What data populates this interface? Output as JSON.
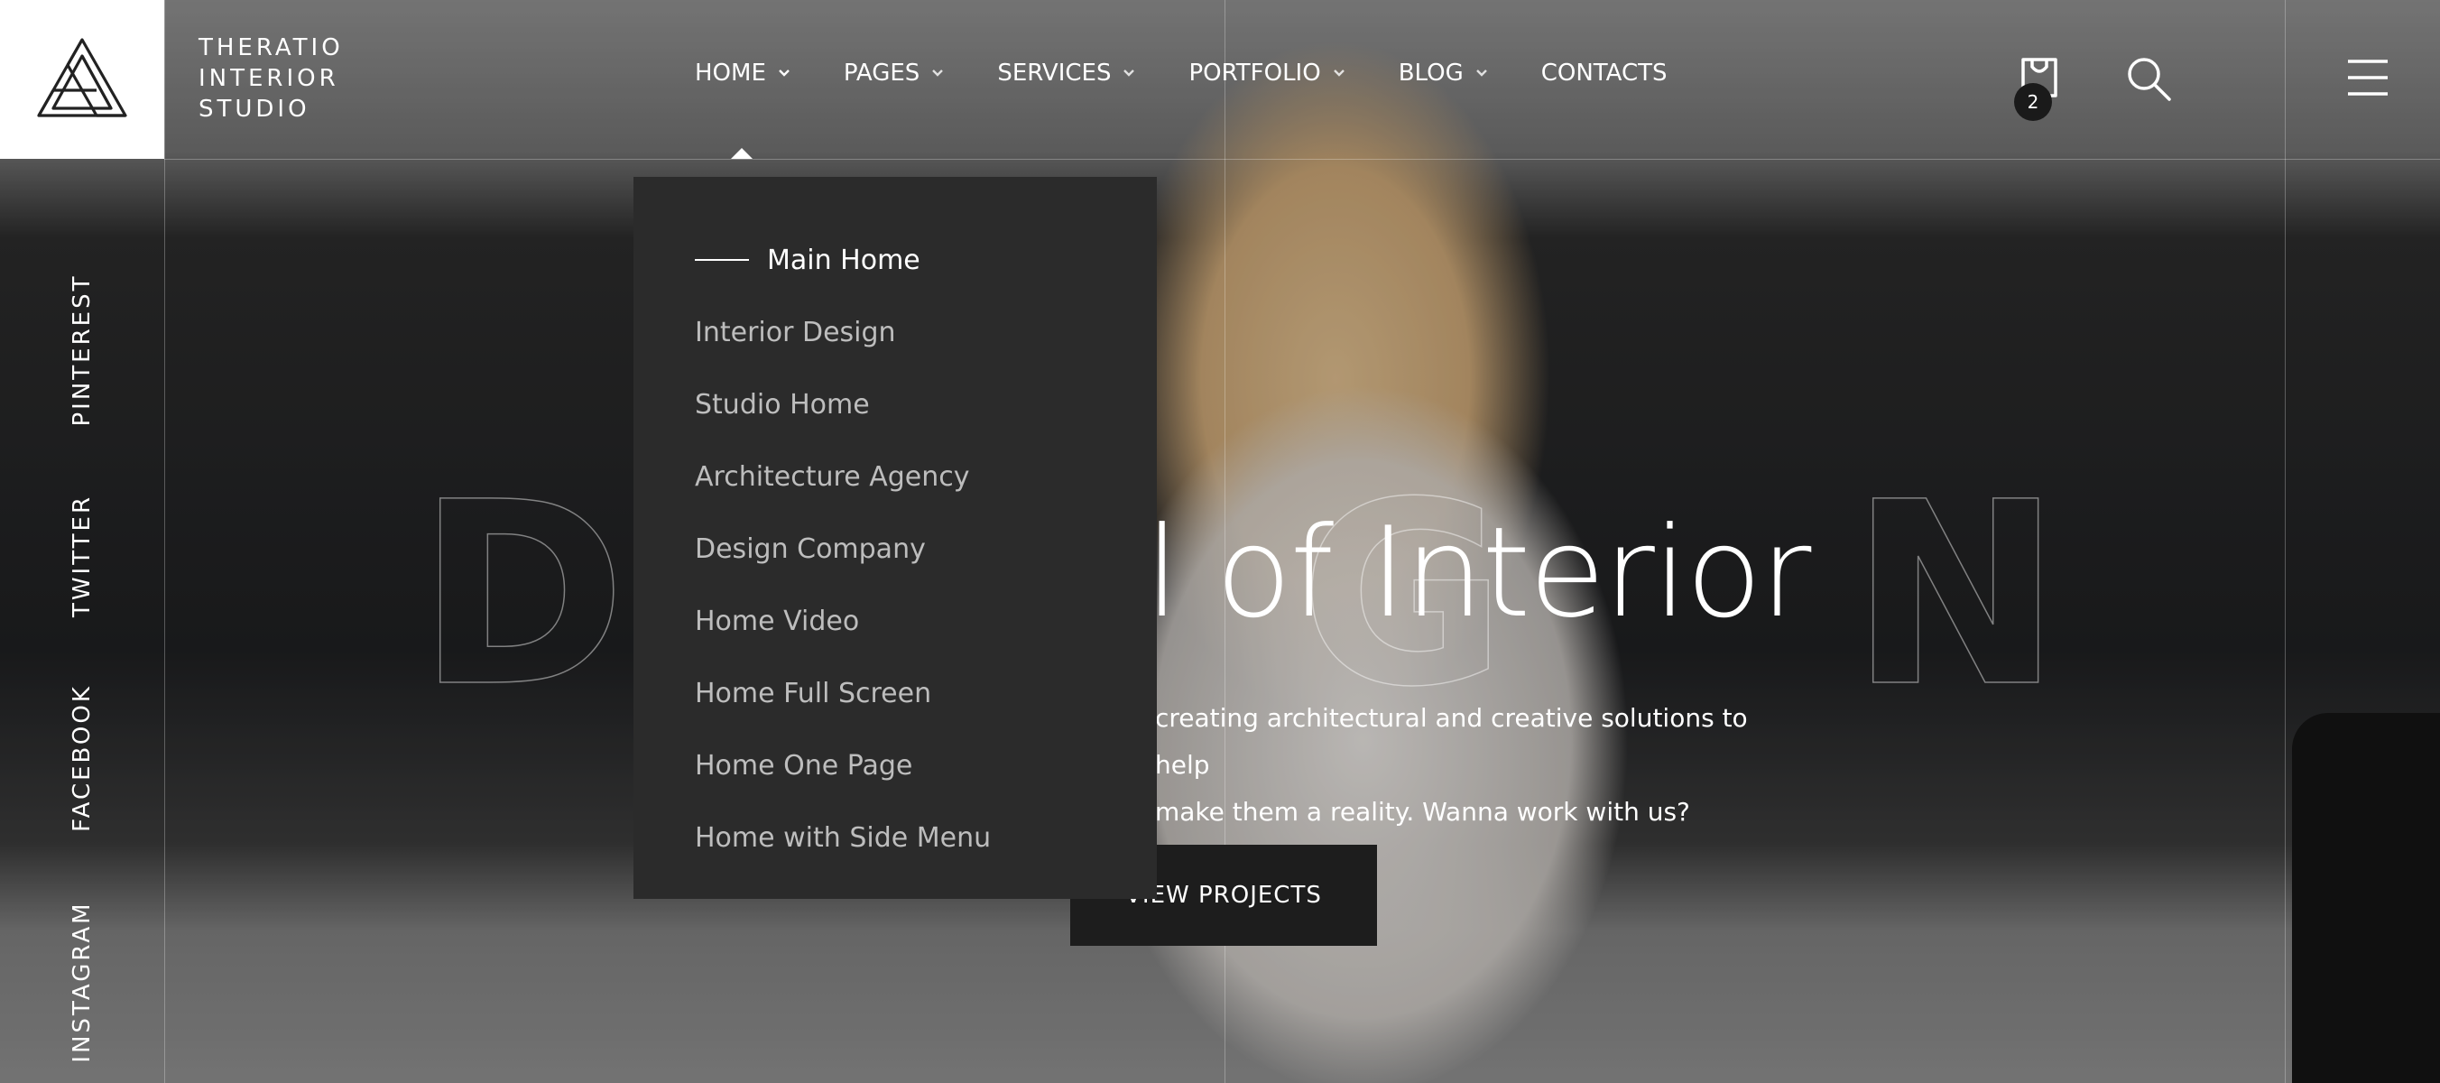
{
  "brand": {
    "lines": [
      "THERATIO",
      "INTERIOR",
      "STUDIO"
    ]
  },
  "nav": {
    "items": [
      {
        "label": "HOME",
        "has_dropdown": true
      },
      {
        "label": "PAGES",
        "has_dropdown": true
      },
      {
        "label": "SERVICES",
        "has_dropdown": true
      },
      {
        "label": "PORTFOLIO",
        "has_dropdown": true
      },
      {
        "label": "BLOG",
        "has_dropdown": true
      },
      {
        "label": "CONTACTS",
        "has_dropdown": false
      }
    ]
  },
  "header_icons": {
    "cart": "cart-icon",
    "cart_count": "2",
    "search": "search-icon",
    "menu": "hamburger-menu-icon"
  },
  "socials": [
    "PINTEREST",
    "TWITTER",
    "FACEBOOK",
    "INSTAGRAM"
  ],
  "hero": {
    "outline_letters": [
      "D",
      "G",
      "N"
    ],
    "headline": "el of Interior",
    "description_lines": [
      "creating architectural and creative solutions to help",
      "make them a reality. Wanna work with us?"
    ],
    "cta_label": "VIEW PROJECTS"
  },
  "dropdown": {
    "items": [
      {
        "label": "Main Home",
        "active": true
      },
      {
        "label": "Interior Design",
        "active": false
      },
      {
        "label": "Studio Home",
        "active": false
      },
      {
        "label": "Architecture Agency",
        "active": false
      },
      {
        "label": "Design Company",
        "active": false
      },
      {
        "label": "Home Video",
        "active": false
      },
      {
        "label": "Home Full Screen",
        "active": false
      },
      {
        "label": "Home One Page",
        "active": false
      },
      {
        "label": "Home with Side Menu",
        "active": false
      }
    ]
  },
  "colors": {
    "dropdown_bg": "#2b2b2b",
    "cta_bg": "#1d1d1d",
    "logo_bg": "#ffffff"
  }
}
